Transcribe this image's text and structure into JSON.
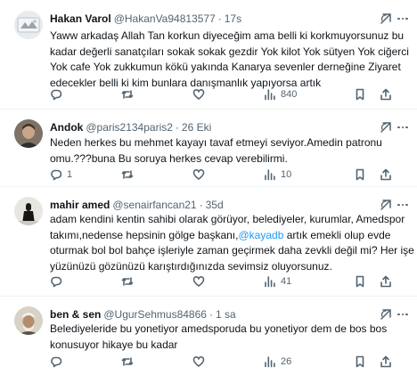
{
  "tweets": [
    {
      "name": "Hakan Varol",
      "handle": "@HakanVa94813577",
      "dot": "·",
      "time": "17s",
      "lines": [
        "Yaww arkadaş Allah Tan korkun diyeceğim ama belli ki korkmuyorsunuz bu",
        "kadar değerli sanatçıları sokak sokak gezdir Yok kilot Yok sütyen Yok ciğerci",
        "Yok cafe Yok zukkumun kökü yakında Kanarya sevenler derneğine Ziyaret",
        "edecekler belli ki kim bunlara danışmanlık yapıyorsa artık"
      ],
      "replies": "",
      "retweets": "",
      "likes": "",
      "views": "840"
    },
    {
      "name": "Andok",
      "handle": "@paris2134paris2",
      "dot": "·",
      "time": "26 Eki",
      "lines": [
        "Neden herkes bu mehmet kayayı tavaf etmeyi seviyor.Amedin patronu",
        "omu.???buna Bu soruya herkes cevap verebilirmi."
      ],
      "replies": "1",
      "retweets": "",
      "likes": "",
      "views": "10"
    },
    {
      "name": "mahir amed",
      "handle": "@senairfancan21",
      "dot": "·",
      "time": "35d",
      "lines_rich": {
        "l1": "adam kendini kentin sahibi olarak  görüyor, belediyeler, kurumlar, Amedspor",
        "l2_pre": "takımı,nedense hepsinin gölge başkanı,",
        "l2_mention": "@kayadb",
        "l2_post": " artık emekli olup evde",
        "l3": "oturmak bol bol bahçe işleriyle zaman geçirmek daha zevkli değil mi? Her işe",
        "l4": "yüzünüzü gözünüzü karıştırdığınızda sevimsiz oluyorsunuz."
      },
      "replies": "",
      "retweets": "",
      "likes": "",
      "views": "41"
    },
    {
      "name": "ben & sen",
      "handle": "@UgurSehmus84866",
      "dot": "·",
      "time": "1 sa",
      "lines": [
        "Belediyeleride bu yonetiyor amedsporuda bu yonetiyor  dem de bos bos",
        "konusuyor hikaye bu kadar"
      ],
      "replies": "",
      "retweets": "",
      "likes": "",
      "views": "26"
    }
  ],
  "colors": {
    "text": "#0f1419",
    "secondary": "#536471",
    "link": "#1d9bf0",
    "divider": "#eff3f4"
  },
  "icons": [
    "reply-icon",
    "retweet-icon",
    "like-icon",
    "views-icon",
    "bookmark-icon",
    "share-icon",
    "grok-icon",
    "more-icon"
  ]
}
